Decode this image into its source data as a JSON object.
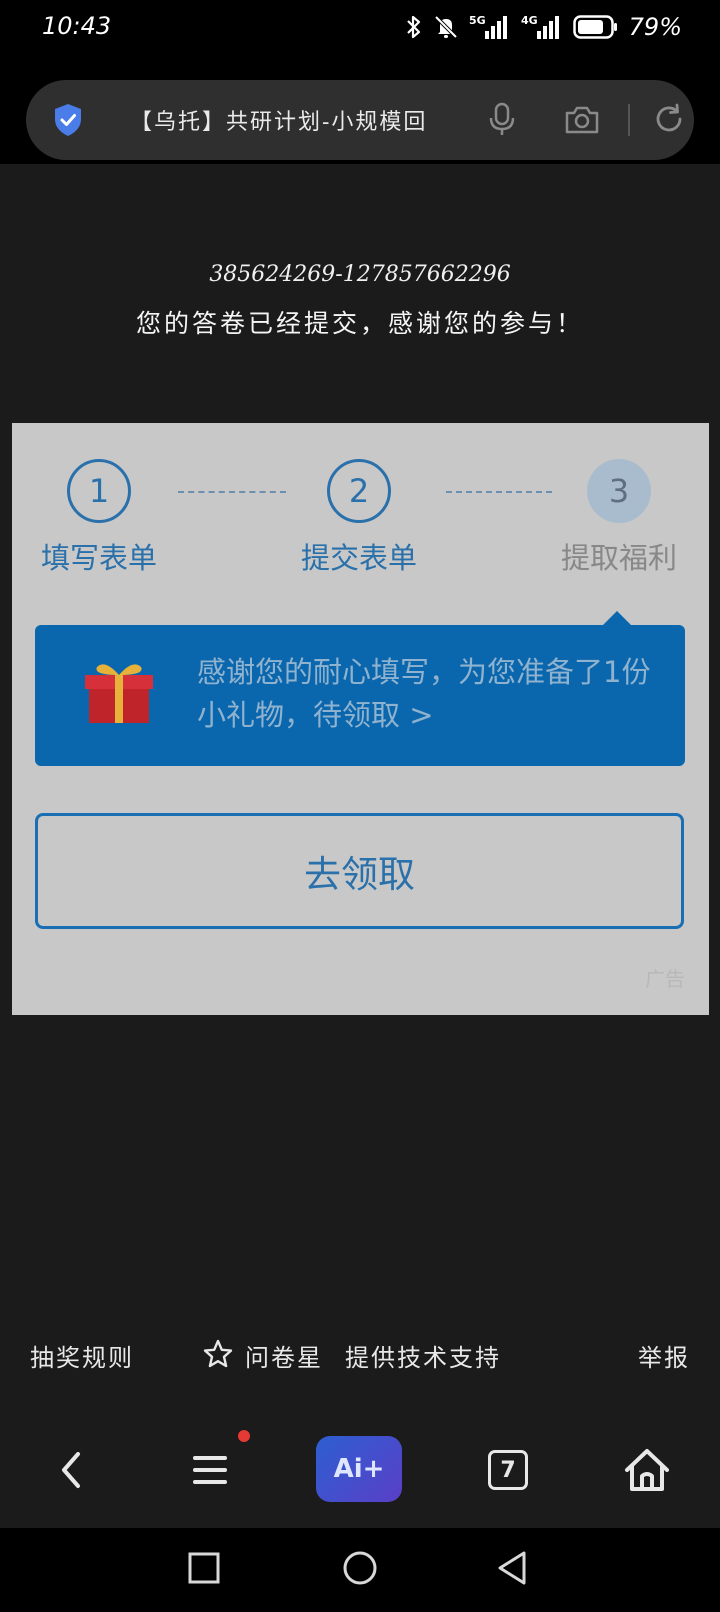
{
  "status_bar": {
    "time": "10:43",
    "battery": "79%",
    "icons": [
      "bluetooth-icon",
      "mute-icon",
      "signal-5g-icon",
      "signal-4g-icon",
      "battery-icon"
    ],
    "network_5g": "5G",
    "network_4g": "4G"
  },
  "address_bar": {
    "title": "【乌托】共研计划-小规模回",
    "icons": [
      "shield-icon",
      "mic-icon",
      "camera-icon",
      "refresh-icon"
    ]
  },
  "content": {
    "submit_id": "385624269-127857662296",
    "submit_message": "您的答卷已经提交，感谢您的参与！"
  },
  "promo": {
    "steps": [
      {
        "number": "1",
        "label": "填写表单"
      },
      {
        "number": "2",
        "label": "提交表单"
      },
      {
        "number": "3",
        "label": "提取福利"
      }
    ],
    "gift_text": "感谢您的耐心填写，为您准备了1份小礼物，待领取 >",
    "claim_button": "去领取",
    "ad_label": "广告"
  },
  "footer": {
    "rules": "抽奖规则",
    "brand": "问卷星",
    "support": "提供技术支持",
    "report": "举报"
  },
  "toolbar": {
    "ai_label": "Ai+",
    "tab_count": "7"
  },
  "colors": {
    "accent_blue": "#0a66ad",
    "step_blue": "#2a70aa",
    "background": "#1b1b1b",
    "badge_red": "#e53935"
  }
}
